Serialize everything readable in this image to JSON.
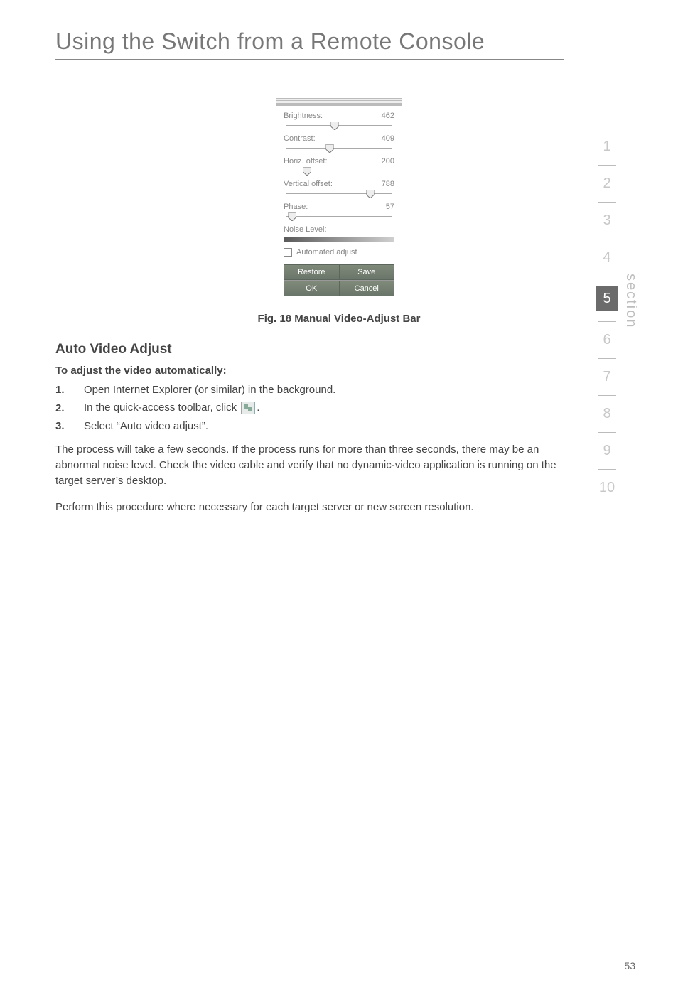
{
  "page": {
    "title": "Using the Switch from a Remote Console",
    "number": "53"
  },
  "panel": {
    "rows": [
      {
        "label": "Brightness:",
        "value": "462",
        "pos": 46
      },
      {
        "label": "Contrast:",
        "value": "409",
        "pos": 41
      },
      {
        "label": "Horiz. offset:",
        "value": "200",
        "pos": 20
      },
      {
        "label": "Vertical offset:",
        "value": "788",
        "pos": 79
      },
      {
        "label": "Phase:",
        "value": "57",
        "pos": 6
      }
    ],
    "noise_label": "Noise Level:",
    "checkbox_label": "Automated adjust",
    "buttons": {
      "restore": "Restore",
      "save": "Save",
      "ok": "OK",
      "cancel": "Cancel"
    }
  },
  "figure_caption": "Fig. 18 Manual Video-Adjust Bar",
  "headings": {
    "auto_video": "Auto Video Adjust",
    "to_adjust": "To adjust the video automatically:"
  },
  "steps": [
    {
      "num": "1.",
      "text": "Open Internet Explorer (or similar) in the background."
    },
    {
      "num": "2.",
      "pre": "In the quick-access toolbar, click ",
      "post": "."
    },
    {
      "num": "3.",
      "text": "Select “Auto video adjust”."
    }
  ],
  "paragraphs": {
    "p1": "The process will take a few seconds. If the process runs for more than three seconds, there may be an abnormal noise level. Check the video cable and verify that no dynamic-video application is running on the target server’s desktop.",
    "p2": "Perform this procedure where necessary for each target server or new screen resolution."
  },
  "side": {
    "numbers": [
      "1",
      "2",
      "3",
      "4",
      "5",
      "6",
      "7",
      "8",
      "9",
      "10"
    ],
    "active_index": 4,
    "label": "section"
  }
}
